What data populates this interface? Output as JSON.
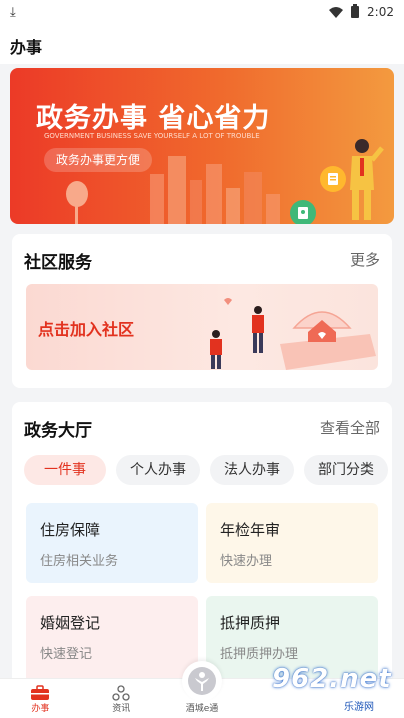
{
  "status_bar": {
    "time": "2:02"
  },
  "header": {
    "title": "办事"
  },
  "banner": {
    "slogan": "政务办事 省心省力",
    "subtitle": "GOVERNMENT BUSINESS SAVE YOURSELF A LOT OF TROUBLE",
    "pill": "政务办事更方便"
  },
  "community": {
    "title": "社区服务",
    "more": "更多",
    "join_label": "点击加入社区"
  },
  "hall": {
    "title": "政务大厅",
    "view_all": "查看全部",
    "tabs": [
      {
        "label": "一件事",
        "active": true
      },
      {
        "label": "个人办事",
        "active": false
      },
      {
        "label": "法人办事",
        "active": false
      },
      {
        "label": "部门分类",
        "active": false
      }
    ],
    "tiles": [
      {
        "name": "住房保障",
        "desc": "住房相关业务"
      },
      {
        "name": "年检年审",
        "desc": "快速办理"
      },
      {
        "name": "婚姻登记",
        "desc": "快速登记"
      },
      {
        "name": "抵押质押",
        "desc": "抵押质押办理"
      }
    ]
  },
  "tabbar": {
    "items": [
      {
        "label": "办事",
        "icon": "briefcase-icon",
        "active": true
      },
      {
        "label": "资讯",
        "icon": "triangle-dots-icon",
        "active": false
      },
      {
        "label": "酒城e通",
        "icon": "center-logo-icon",
        "active": false
      },
      {
        "label": "",
        "icon": "",
        "active": false
      },
      {
        "label": "",
        "icon": "",
        "active": false
      }
    ]
  },
  "watermark": {
    "big": "962.net",
    "small": "乐游网"
  },
  "colors": {
    "accent": "#e2321f",
    "banner_start": "#ec3a27",
    "banner_end": "#f39a3f"
  }
}
